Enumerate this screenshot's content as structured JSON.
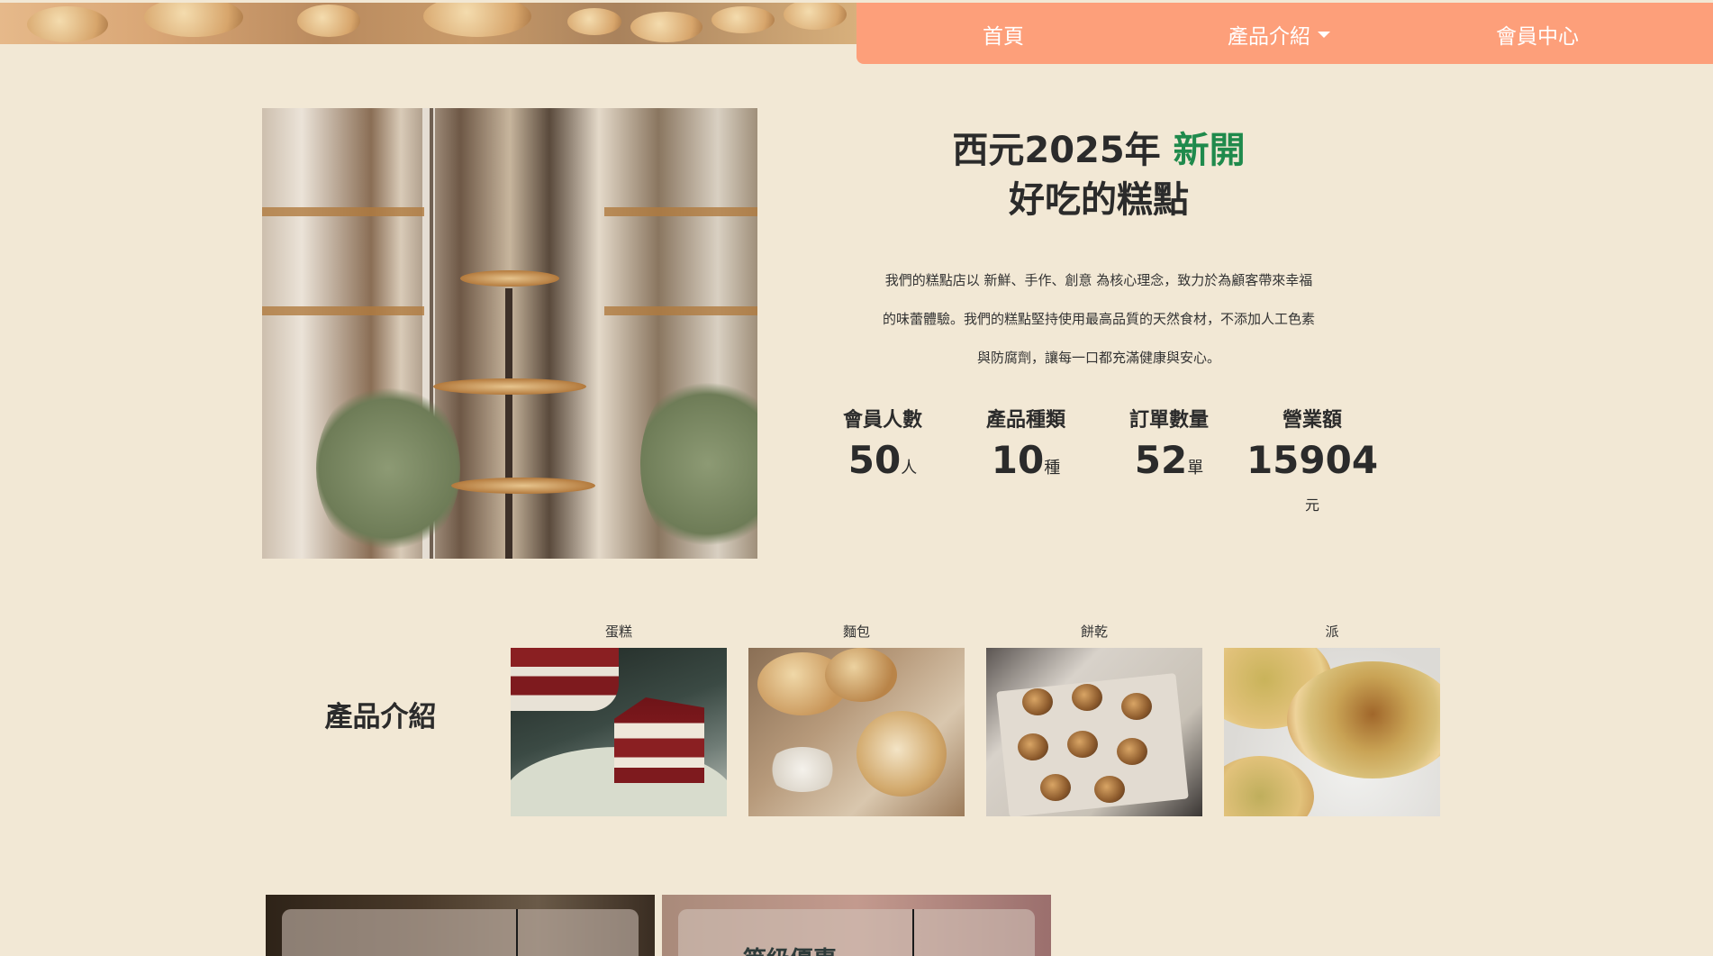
{
  "nav": {
    "home": "首頁",
    "products": "產品介紹",
    "member": "會員中心"
  },
  "hero": {
    "title_prefix": "西元2025年 ",
    "title_accent": "新開",
    "title_line2": "好吃的糕點",
    "desc_lines": [
      "我們的糕點店以 新鮮、手作、創意 為核心理念，致力於為顧客帶來幸福",
      "的味蕾體驗。我們的糕點堅持使用最高品質的天然食材，不添加人工色素",
      "與防腐劑，讓每一口都充滿健康與安心。"
    ]
  },
  "stats": [
    {
      "label": "會員人數",
      "value": "50",
      "unit": "人"
    },
    {
      "label": "產品種類",
      "value": "10",
      "unit": "種"
    },
    {
      "label": "訂單數量",
      "value": "52",
      "unit": "單"
    },
    {
      "label": "營業額",
      "value": "15904",
      "unit": "元"
    }
  ],
  "products": {
    "title": "產品介紹",
    "items": [
      {
        "label": "蛋糕"
      },
      {
        "label": "麵包"
      },
      {
        "label": "餅乾"
      },
      {
        "label": "派"
      }
    ]
  },
  "cards": {
    "card2_title": "等級優惠"
  },
  "colors": {
    "background": "#f2e8d5",
    "nav": "#fd9f7a",
    "accent": "#1f8a4c"
  }
}
